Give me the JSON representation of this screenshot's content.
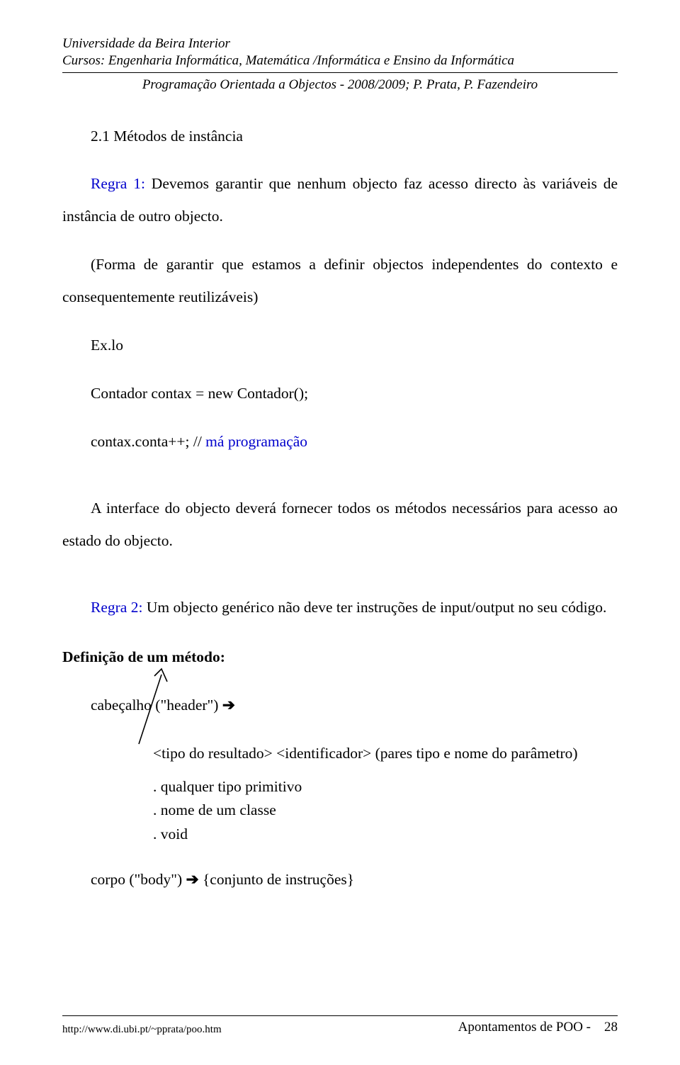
{
  "header": {
    "line1": "Universidade da Beira Interior",
    "line2": "Cursos: Engenharia Informática, Matemática /Informática e Ensino da Informática",
    "subline": "Programação Orientada a Objectos - 2008/2009; P. Prata, P. Fazendeiro"
  },
  "body": {
    "section_title": "2.1 Métodos de instância",
    "regra1_label": "Regra 1:",
    "regra1_text": " Devemos garantir que nenhum objecto faz acesso directo às variáveis de instância de outro objecto.",
    "forma_text": "(Forma de garantir que estamos a definir objectos independentes do contexto e consequentemente reutilizáveis)",
    "exlo": "Ex.lo",
    "code1": "Contador contax = new Contador();",
    "code2_a": "contax.conta++;  //  ",
    "code2_b": "má programação",
    "interface_text": "A interface do objecto deverá fornecer todos os métodos necessários para acesso ao estado do objecto.",
    "regra2_label": "Regra 2:",
    "regra2_text": " Um objecto genérico não deve ter instruções de input/output no seu código.",
    "def_metodo": "Definição de um método:",
    "cabecalho_a": "cabeçalho (\"header\") ",
    "arrow": "➔",
    "tipo_line": "<tipo do resultado> <identificador> (pares tipo e nome do parâmetro)",
    "dot1": ". qualquer tipo primitivo",
    "dot2": ". nome de um classe",
    "dot3": ". void",
    "corpo_a": "corpo (\"body\") ",
    "corpo_b": " {conjunto de instruções}"
  },
  "footer": {
    "url": "http://www.di.ubi.pt/~pprata/poo.htm",
    "right_label": "Apontamentos de POO -",
    "page_num": "28"
  }
}
